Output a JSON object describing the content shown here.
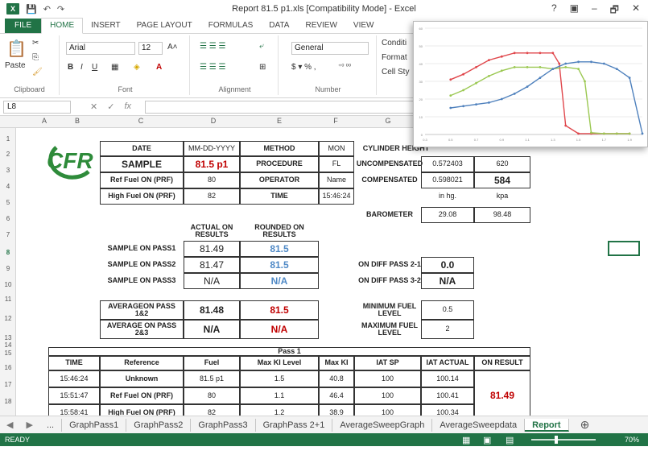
{
  "app": {
    "window_title": "Report 81.5 p1.xls  [Compatibility Mode] - Excel",
    "logo_text": "X",
    "qat_icons": [
      "save-icon",
      "undo-icon",
      "redo-icon"
    ],
    "window_controls": [
      "?",
      "▣",
      "–",
      "🗗",
      "✕"
    ]
  },
  "ribbon_tabs": [
    "FILE",
    "HOME",
    "INSERT",
    "PAGE LAYOUT",
    "FORMULAS",
    "DATA",
    "REVIEW",
    "VIEW"
  ],
  "ribbon": {
    "clipboard_label": "Clipboard",
    "paste_label": "Paste",
    "font_label": "Font",
    "font_name": "Arial",
    "font_size": "12",
    "alignment_label": "Alignment",
    "number_label": "Number",
    "number_format": "General",
    "styles": [
      "Conditi",
      "Format",
      "Cell Sty"
    ]
  },
  "formula_bar": {
    "name_box": "L8",
    "formula": ""
  },
  "columns": [
    "A",
    "B",
    "C",
    "D",
    "E",
    "F",
    "G"
  ],
  "rows": [
    "1",
    "2",
    "3",
    "4",
    "5",
    "6",
    "7",
    "8",
    "9",
    "10",
    "11",
    "12",
    "13",
    "14",
    "15",
    "16",
    "17",
    "18"
  ],
  "logo": "CFR",
  "header": {
    "date_label": "DATE",
    "date_value": "MM-DD-YYYY",
    "method_label": "METHOD",
    "method_value": "MON",
    "cyl_label": "CYLINDER HEIGHT",
    "sample_label": "SAMPLE",
    "sample_value": "81.5 p1",
    "procedure_label": "PROCEDURE",
    "procedure_value": "FL",
    "uncomp_label": "UNCOMPENSATED",
    "uncomp_value": "0.572403",
    "uncomp_kpa": "620",
    "ref_label": "Ref Fuel ON (PRF)",
    "ref_value": "80",
    "operator_label": "OPERATOR",
    "operator_value": "Name",
    "comp_label": "COMPENSATED",
    "comp_value": "0.598021",
    "comp_kpa": "584",
    "high_label": "High Fuel ON (PRF)",
    "high_value": "82",
    "time_label": "TIME",
    "time_value": "15:46:24",
    "unit_inhg": "in hg.",
    "unit_kpa": "kpa",
    "baro_label": "BAROMETER",
    "baro_value": "29.08",
    "baro_kpa": "98.48"
  },
  "results": {
    "actual_hdr": "ACTUAL ON RESULTS",
    "rounded_hdr": "ROUNDED ON RESULTS",
    "pass1_label": "SAMPLE ON PASS1",
    "pass1_actual": "81.49",
    "pass1_rounded": "81.5",
    "pass2_label": "SAMPLE ON PASS2",
    "pass2_actual": "81.47",
    "pass2_rounded": "81.5",
    "pass3_label": "SAMPLE ON PASS3",
    "pass3_actual": "N/A",
    "pass3_rounded": "N/A",
    "diff21_label": "ON DIFF PASS 2-1",
    "diff21_value": "0.0",
    "diff32_label": "ON DIFF PASS 3-2",
    "diff32_value": "N/A",
    "avg12_label": "AVERAGEON PASS 1&2",
    "avg12_actual": "81.48",
    "avg12_rounded": "81.5",
    "avg23_label": "AVERAGE ON PASS 2&3",
    "avg23_actual": "N/A",
    "avg23_rounded": "N/A",
    "minfuel_label": "MINIMUM FUEL LEVEL",
    "minfuel_value": "0.5",
    "maxfuel_label": "MAXIMUM FUEL LEVEL",
    "maxfuel_value": "2"
  },
  "pass_table": {
    "title": "Pass 1",
    "headers": [
      "TIME",
      "Reference",
      "Fuel",
      "Max KI Level",
      "Max KI",
      "IAT SP",
      "IAT ACTUAL",
      "ON RESULT"
    ],
    "rows": [
      [
        "15:46:24",
        "Unknown",
        "81.5 p1",
        "1.5",
        "40.8",
        "100",
        "100.14"
      ],
      [
        "15:51:47",
        "Ref Fuel ON (PRF)",
        "80",
        "1.1",
        "46.4",
        "100",
        "100.41"
      ],
      [
        "15:58:41",
        "High Fuel ON (PRF)",
        "82",
        "1.2",
        "38.9",
        "100",
        "100.34"
      ]
    ],
    "on_result": "81.49"
  },
  "sheet_tabs": [
    "...",
    "GraphPass1",
    "GraphPass2",
    "GraphPass3",
    "GraphPass 2+1",
    "AverageSweepGraph",
    "AverageSweepdata",
    "Report"
  ],
  "status": {
    "ready": "READY",
    "zoom": "70%"
  },
  "colors": {
    "excel_green": "#217346",
    "red_series": "#e0474c",
    "green_series": "#9bc852",
    "blue_series": "#4f81bd"
  },
  "chart_data": {
    "type": "line",
    "x_ticks": [
      "0.3",
      "0.5",
      "0.7",
      "0.9",
      "1.1",
      "1.3",
      "1.5",
      "1.7",
      "1.9"
    ],
    "y_ticks": [
      "0",
      "10",
      "20",
      "30",
      "40",
      "50",
      "60"
    ],
    "xlim": [
      0.3,
      2.0
    ],
    "ylim": [
      0,
      60
    ],
    "grid": true,
    "series": [
      {
        "color": "#e0474c",
        "x": [
          0.5,
          0.6,
          0.7,
          0.8,
          0.9,
          1.0,
          1.1,
          1.2,
          1.3,
          1.35,
          1.4,
          1.5,
          1.6,
          1.7,
          1.8,
          1.9
        ],
        "values": [
          31,
          34,
          38,
          42,
          44,
          46,
          46,
          46,
          46,
          40,
          5,
          0.5,
          0.5,
          0.5,
          0.5,
          0.5
        ]
      },
      {
        "color": "#9bc852",
        "x": [
          0.5,
          0.6,
          0.7,
          0.8,
          0.9,
          1.0,
          1.1,
          1.2,
          1.3,
          1.4,
          1.5,
          1.55,
          1.6,
          1.7,
          1.8,
          1.9
        ],
        "values": [
          22,
          25,
          29,
          33,
          36,
          38,
          38,
          38,
          37,
          38,
          37,
          30,
          1,
          0.5,
          0.5,
          0.5
        ]
      },
      {
        "color": "#4f81bd",
        "x": [
          0.5,
          0.6,
          0.7,
          0.8,
          0.9,
          1.0,
          1.1,
          1.2,
          1.3,
          1.4,
          1.5,
          1.6,
          1.7,
          1.8,
          1.9,
          2.0
        ],
        "values": [
          15,
          16,
          17,
          18,
          20,
          23,
          27,
          32,
          37,
          40,
          41,
          41,
          40,
          37,
          32,
          0.5
        ]
      }
    ]
  }
}
